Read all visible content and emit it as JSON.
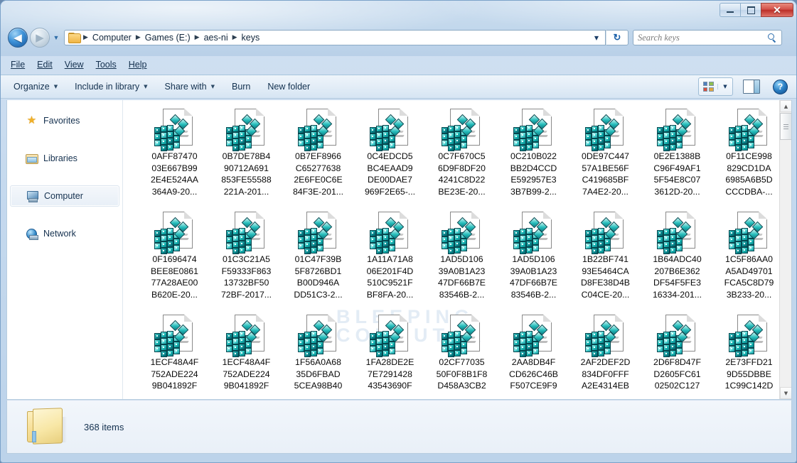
{
  "window": {
    "controls": {
      "minimize": "–",
      "maximize": "□",
      "close": "✕"
    }
  },
  "address_bar": {
    "back_label": "◀",
    "forward_label": "▶",
    "history_caret": "▼",
    "breadcrumbs": [
      "Computer",
      "Games (E:)",
      "aes-ni",
      "keys"
    ],
    "separator": "▶",
    "dropdown_caret": "▼",
    "refresh_label": "↻",
    "folder_icon": "folder-icon"
  },
  "search": {
    "placeholder": "Search keys",
    "icon": "search-icon"
  },
  "menu": {
    "items": [
      "File",
      "Edit",
      "View",
      "Tools",
      "Help"
    ]
  },
  "toolbar": {
    "items": [
      {
        "label": "Organize",
        "caret": "▼"
      },
      {
        "label": "Include in library",
        "caret": "▼"
      },
      {
        "label": "Share with",
        "caret": "▼"
      },
      {
        "label": "Burn",
        "caret": ""
      },
      {
        "label": "New folder",
        "caret": ""
      }
    ],
    "view_caret": "▼",
    "help_label": "?"
  },
  "sidebar": {
    "items": [
      {
        "label": "Favorites",
        "icon": "star-icon",
        "selected": false
      },
      {
        "label": "Libraries",
        "icon": "library-icon",
        "selected": false
      },
      {
        "label": "Computer",
        "icon": "computer-icon",
        "selected": true
      },
      {
        "label": "Network",
        "icon": "network-icon",
        "selected": false
      }
    ]
  },
  "watermark": {
    "line1": "BLEEPING",
    "line2": "COMPUTER"
  },
  "files": [
    {
      "lines": [
        "0AFF87470",
        "03E667B99",
        "2E4E524AA",
        "364A9-20..."
      ]
    },
    {
      "lines": [
        "0B7DE78B4",
        "90712A691",
        "853FE55588",
        "221A-201..."
      ]
    },
    {
      "lines": [
        "0B7EF8966",
        "C65277638",
        "2E6FE0C6E",
        "84F3E-201..."
      ]
    },
    {
      "lines": [
        "0C4EDCD5",
        "BC4EAAD9",
        "DE00DAE7",
        "969F2E65-..."
      ]
    },
    {
      "lines": [
        "0C7F670C5",
        "6D9F8DF20",
        "4241C8D22",
        "BE23E-20..."
      ]
    },
    {
      "lines": [
        "0C210B022",
        "BB2D4CCD",
        "E592957E3",
        "3B7B99-2..."
      ]
    },
    {
      "lines": [
        "0DE97C447",
        "57A1BE56F",
        "C419685BF",
        "7A4E2-20..."
      ]
    },
    {
      "lines": [
        "0E2E1388B",
        "C96F49AF1",
        "5F54E8C07",
        "3612D-20..."
      ]
    },
    {
      "lines": [
        "0F11CE998",
        "829CD1DA",
        "6985A6B5D",
        "CCCDBA-..."
      ]
    },
    {
      "lines": [
        "0F1696474",
        "BEE8E0861",
        "77A28AE00",
        "B620E-20..."
      ]
    },
    {
      "lines": [
        "01C3C21A5",
        "F59333F863",
        "13732BF50",
        "72BF-2017..."
      ]
    },
    {
      "lines": [
        "01C47F39B",
        "5F8726BD1",
        "B00D946A",
        "DD51C3-2..."
      ]
    },
    {
      "lines": [
        "1A11A71A8",
        "06E201F4D",
        "510C9521F",
        "BF8FA-20..."
      ]
    },
    {
      "lines": [
        "1AD5D106",
        "39A0B1A23",
        "47DF66B7E",
        "83546B-2..."
      ]
    },
    {
      "lines": [
        "1AD5D106",
        "39A0B1A23",
        "47DF66B7E",
        "83546B-2..."
      ]
    },
    {
      "lines": [
        "1B22BF741",
        "93E5464CA",
        "D8FE38D4B",
        "C04CE-20..."
      ]
    },
    {
      "lines": [
        "1B64ADC40",
        "207B6E362",
        "DF54F5FE3",
        "16334-201..."
      ]
    },
    {
      "lines": [
        "1C5F86AA0",
        "A5AD49701",
        "FCA5C8D79",
        "3B233-20..."
      ]
    },
    {
      "lines": [
        "1ECF48A4F",
        "752ADE224",
        "9B041892F"
      ]
    },
    {
      "lines": [
        "1ECF48A4F",
        "752ADE224",
        "9B041892F"
      ]
    },
    {
      "lines": [
        "1F56A0A68",
        "35D6FBAD",
        "5CEA98B40"
      ]
    },
    {
      "lines": [
        "1FA28DE2E",
        "7E7291428",
        "43543690F"
      ]
    },
    {
      "lines": [
        "02CF77035",
        "50F0F8B1F8",
        "D458A3CB2"
      ]
    },
    {
      "lines": [
        "2AA8DB4F",
        "CD626C46B",
        "F507CE9F9"
      ]
    },
    {
      "lines": [
        "2AF2DEF2D",
        "834DF0FFF",
        "A2E4314EB"
      ]
    },
    {
      "lines": [
        "2D6F8D47F",
        "D2605FC61",
        "02502C127"
      ]
    },
    {
      "lines": [
        "2E73FFD21",
        "9D55DBBE",
        "1C99C142D"
      ]
    }
  ],
  "scrollbar": {
    "up_arrow": "▲",
    "down_arrow": "▼"
  },
  "status": {
    "item_count": "368 items",
    "folder_icon": "folder-icon"
  },
  "colors": {
    "accent": "#15539b",
    "close_button": "#bb3029",
    "icon_teal": "#17b2b0",
    "window_chrome": "#c3d8ec"
  }
}
